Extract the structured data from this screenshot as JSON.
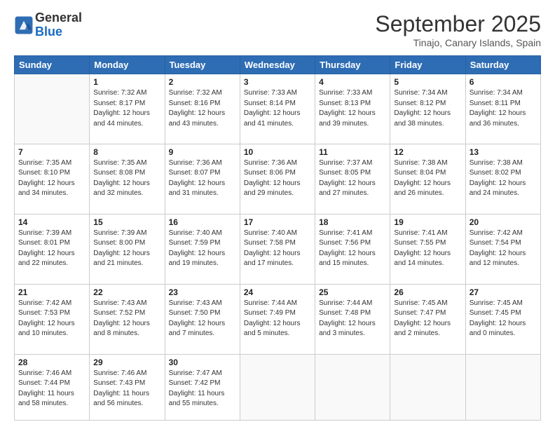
{
  "header": {
    "logo_line1": "General",
    "logo_line2": "Blue",
    "month": "September 2025",
    "location": "Tinajo, Canary Islands, Spain"
  },
  "weekdays": [
    "Sunday",
    "Monday",
    "Tuesday",
    "Wednesday",
    "Thursday",
    "Friday",
    "Saturday"
  ],
  "weeks": [
    [
      {
        "day": "",
        "info": ""
      },
      {
        "day": "1",
        "info": "Sunrise: 7:32 AM\nSunset: 8:17 PM\nDaylight: 12 hours\nand 44 minutes."
      },
      {
        "day": "2",
        "info": "Sunrise: 7:32 AM\nSunset: 8:16 PM\nDaylight: 12 hours\nand 43 minutes."
      },
      {
        "day": "3",
        "info": "Sunrise: 7:33 AM\nSunset: 8:14 PM\nDaylight: 12 hours\nand 41 minutes."
      },
      {
        "day": "4",
        "info": "Sunrise: 7:33 AM\nSunset: 8:13 PM\nDaylight: 12 hours\nand 39 minutes."
      },
      {
        "day": "5",
        "info": "Sunrise: 7:34 AM\nSunset: 8:12 PM\nDaylight: 12 hours\nand 38 minutes."
      },
      {
        "day": "6",
        "info": "Sunrise: 7:34 AM\nSunset: 8:11 PM\nDaylight: 12 hours\nand 36 minutes."
      }
    ],
    [
      {
        "day": "7",
        "info": "Sunrise: 7:35 AM\nSunset: 8:10 PM\nDaylight: 12 hours\nand 34 minutes."
      },
      {
        "day": "8",
        "info": "Sunrise: 7:35 AM\nSunset: 8:08 PM\nDaylight: 12 hours\nand 32 minutes."
      },
      {
        "day": "9",
        "info": "Sunrise: 7:36 AM\nSunset: 8:07 PM\nDaylight: 12 hours\nand 31 minutes."
      },
      {
        "day": "10",
        "info": "Sunrise: 7:36 AM\nSunset: 8:06 PM\nDaylight: 12 hours\nand 29 minutes."
      },
      {
        "day": "11",
        "info": "Sunrise: 7:37 AM\nSunset: 8:05 PM\nDaylight: 12 hours\nand 27 minutes."
      },
      {
        "day": "12",
        "info": "Sunrise: 7:38 AM\nSunset: 8:04 PM\nDaylight: 12 hours\nand 26 minutes."
      },
      {
        "day": "13",
        "info": "Sunrise: 7:38 AM\nSunset: 8:02 PM\nDaylight: 12 hours\nand 24 minutes."
      }
    ],
    [
      {
        "day": "14",
        "info": "Sunrise: 7:39 AM\nSunset: 8:01 PM\nDaylight: 12 hours\nand 22 minutes."
      },
      {
        "day": "15",
        "info": "Sunrise: 7:39 AM\nSunset: 8:00 PM\nDaylight: 12 hours\nand 21 minutes."
      },
      {
        "day": "16",
        "info": "Sunrise: 7:40 AM\nSunset: 7:59 PM\nDaylight: 12 hours\nand 19 minutes."
      },
      {
        "day": "17",
        "info": "Sunrise: 7:40 AM\nSunset: 7:58 PM\nDaylight: 12 hours\nand 17 minutes."
      },
      {
        "day": "18",
        "info": "Sunrise: 7:41 AM\nSunset: 7:56 PM\nDaylight: 12 hours\nand 15 minutes."
      },
      {
        "day": "19",
        "info": "Sunrise: 7:41 AM\nSunset: 7:55 PM\nDaylight: 12 hours\nand 14 minutes."
      },
      {
        "day": "20",
        "info": "Sunrise: 7:42 AM\nSunset: 7:54 PM\nDaylight: 12 hours\nand 12 minutes."
      }
    ],
    [
      {
        "day": "21",
        "info": "Sunrise: 7:42 AM\nSunset: 7:53 PM\nDaylight: 12 hours\nand 10 minutes."
      },
      {
        "day": "22",
        "info": "Sunrise: 7:43 AM\nSunset: 7:52 PM\nDaylight: 12 hours\nand 8 minutes."
      },
      {
        "day": "23",
        "info": "Sunrise: 7:43 AM\nSunset: 7:50 PM\nDaylight: 12 hours\nand 7 minutes."
      },
      {
        "day": "24",
        "info": "Sunrise: 7:44 AM\nSunset: 7:49 PM\nDaylight: 12 hours\nand 5 minutes."
      },
      {
        "day": "25",
        "info": "Sunrise: 7:44 AM\nSunset: 7:48 PM\nDaylight: 12 hours\nand 3 minutes."
      },
      {
        "day": "26",
        "info": "Sunrise: 7:45 AM\nSunset: 7:47 PM\nDaylight: 12 hours\nand 2 minutes."
      },
      {
        "day": "27",
        "info": "Sunrise: 7:45 AM\nSunset: 7:45 PM\nDaylight: 12 hours\nand 0 minutes."
      }
    ],
    [
      {
        "day": "28",
        "info": "Sunrise: 7:46 AM\nSunset: 7:44 PM\nDaylight: 11 hours\nand 58 minutes."
      },
      {
        "day": "29",
        "info": "Sunrise: 7:46 AM\nSunset: 7:43 PM\nDaylight: 11 hours\nand 56 minutes."
      },
      {
        "day": "30",
        "info": "Sunrise: 7:47 AM\nSunset: 7:42 PM\nDaylight: 11 hours\nand 55 minutes."
      },
      {
        "day": "",
        "info": ""
      },
      {
        "day": "",
        "info": ""
      },
      {
        "day": "",
        "info": ""
      },
      {
        "day": "",
        "info": ""
      }
    ]
  ]
}
